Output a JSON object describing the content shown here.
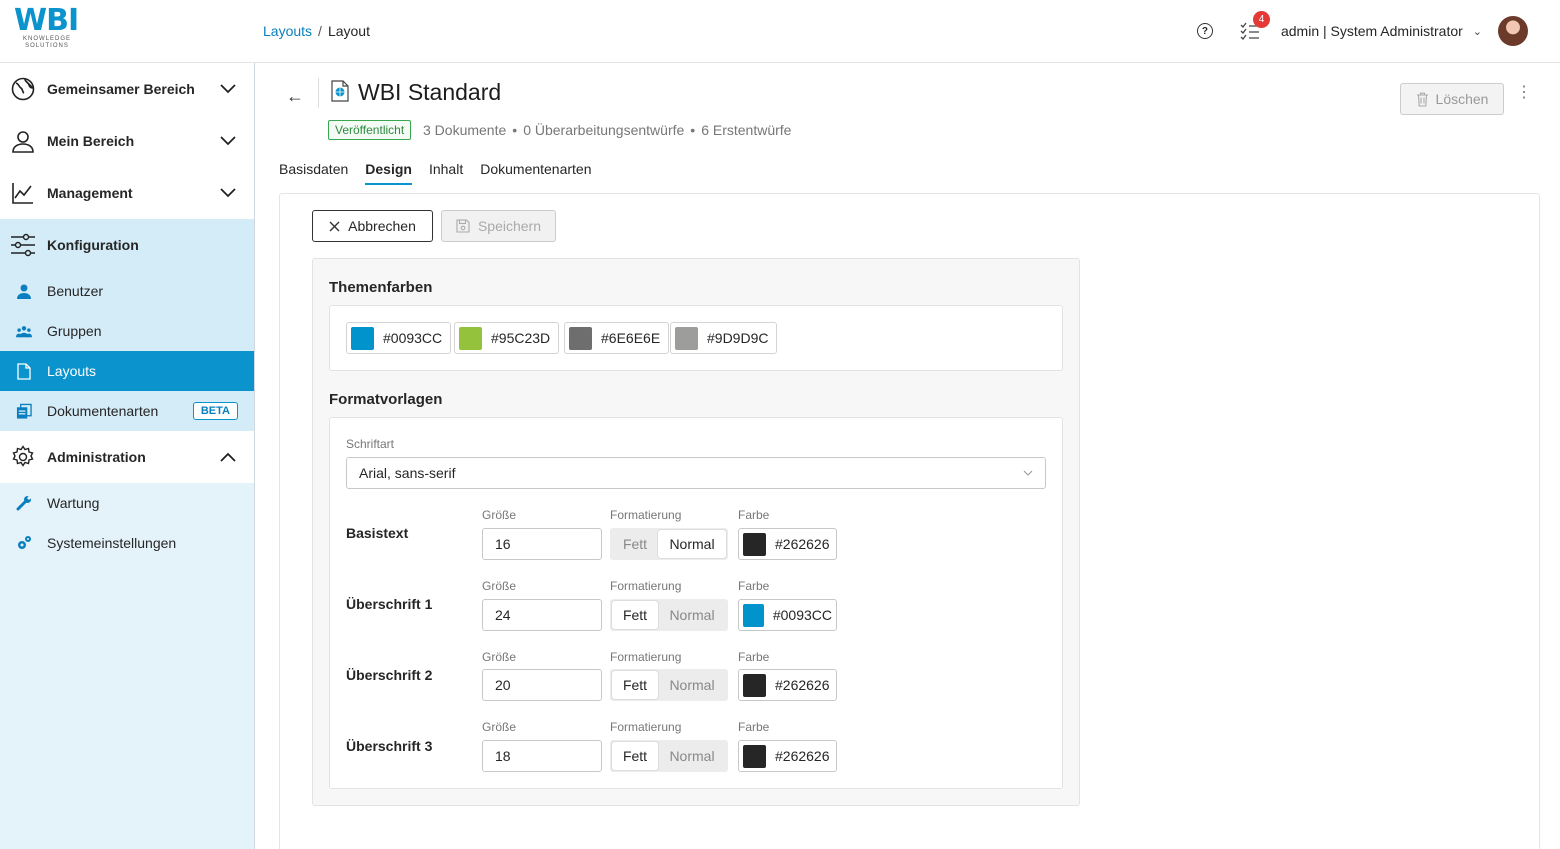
{
  "logo": {
    "text": "WBI",
    "subtext_1": "KNOWLEDGE",
    "subtext_2": "SOLUTIONS"
  },
  "breadcrumb": {
    "parent": "Layouts",
    "separator": "/",
    "current": "Layout"
  },
  "header_right": {
    "tasks_count": "4",
    "user_label": "admin | System Administrator"
  },
  "sidebar": {
    "groups": [
      {
        "label": "Gemeinsamer Bereich",
        "icon": "globe-icon",
        "expanded": false
      },
      {
        "label": "Mein Bereich",
        "icon": "user-icon",
        "expanded": false
      },
      {
        "label": "Management",
        "icon": "chart-icon",
        "expanded": false
      },
      {
        "label": "Konfiguration",
        "icon": "sliders-icon",
        "expanded": true
      },
      {
        "label": "Administration",
        "icon": "gear-icon",
        "expanded": true
      }
    ],
    "config_items": [
      {
        "label": "Benutzer",
        "icon": "user-small-icon"
      },
      {
        "label": "Gruppen",
        "icon": "group-icon"
      },
      {
        "label": "Layouts",
        "icon": "file-icon",
        "selected": true
      },
      {
        "label": "Dokumentenarten",
        "icon": "documents-icon",
        "badge": "BETA"
      }
    ],
    "admin_items": [
      {
        "label": "Wartung",
        "icon": "wrench-icon"
      },
      {
        "label": "Systemeinstellungen",
        "icon": "cogs-icon"
      }
    ]
  },
  "page": {
    "title": "WBI Standard",
    "status": "Veröffentlicht",
    "meta_docs": "3 Dokumente",
    "meta_revisions": "0 Überarbeitungsentwürfe",
    "meta_drafts": "6 Erstentwürfe",
    "meta_dot": "•",
    "delete_label": "Löschen"
  },
  "tabs": [
    {
      "label": "Basisdaten",
      "active": false
    },
    {
      "label": "Design",
      "active": true
    },
    {
      "label": "Inhalt",
      "active": false
    },
    {
      "label": "Dokumentenarten",
      "active": false
    }
  ],
  "actions": {
    "cancel_label": "Abbrechen",
    "save_label": "Speichern"
  },
  "theme": {
    "title": "Themenfarben",
    "colors": [
      {
        "hex": "#0093CC",
        "value": "#0093CC"
      },
      {
        "hex": "#95C23D",
        "value": "#95C23D"
      },
      {
        "hex": "#6E6E6E",
        "value": "#6E6E6E"
      },
      {
        "hex": "#9D9D9C",
        "value": "#9D9D9C"
      }
    ]
  },
  "formats": {
    "title": "Formatvorlagen",
    "font_label": "Schriftart",
    "font_value": "Arial, sans-serif",
    "col_size": "Größe",
    "col_format": "Formatierung",
    "col_color": "Farbe",
    "bold_label": "Fett",
    "normal_label": "Normal",
    "rows": [
      {
        "label": "Basistext",
        "size": "16",
        "weight": "normal",
        "color": "#262626"
      },
      {
        "label": "Überschrift 1",
        "size": "24",
        "weight": "bold",
        "color": "#0093CC"
      },
      {
        "label": "Überschrift 2",
        "size": "20",
        "weight": "bold",
        "color": "#262626"
      },
      {
        "label": "Überschrift 3",
        "size": "18",
        "weight": "bold",
        "color": "#262626"
      }
    ]
  }
}
